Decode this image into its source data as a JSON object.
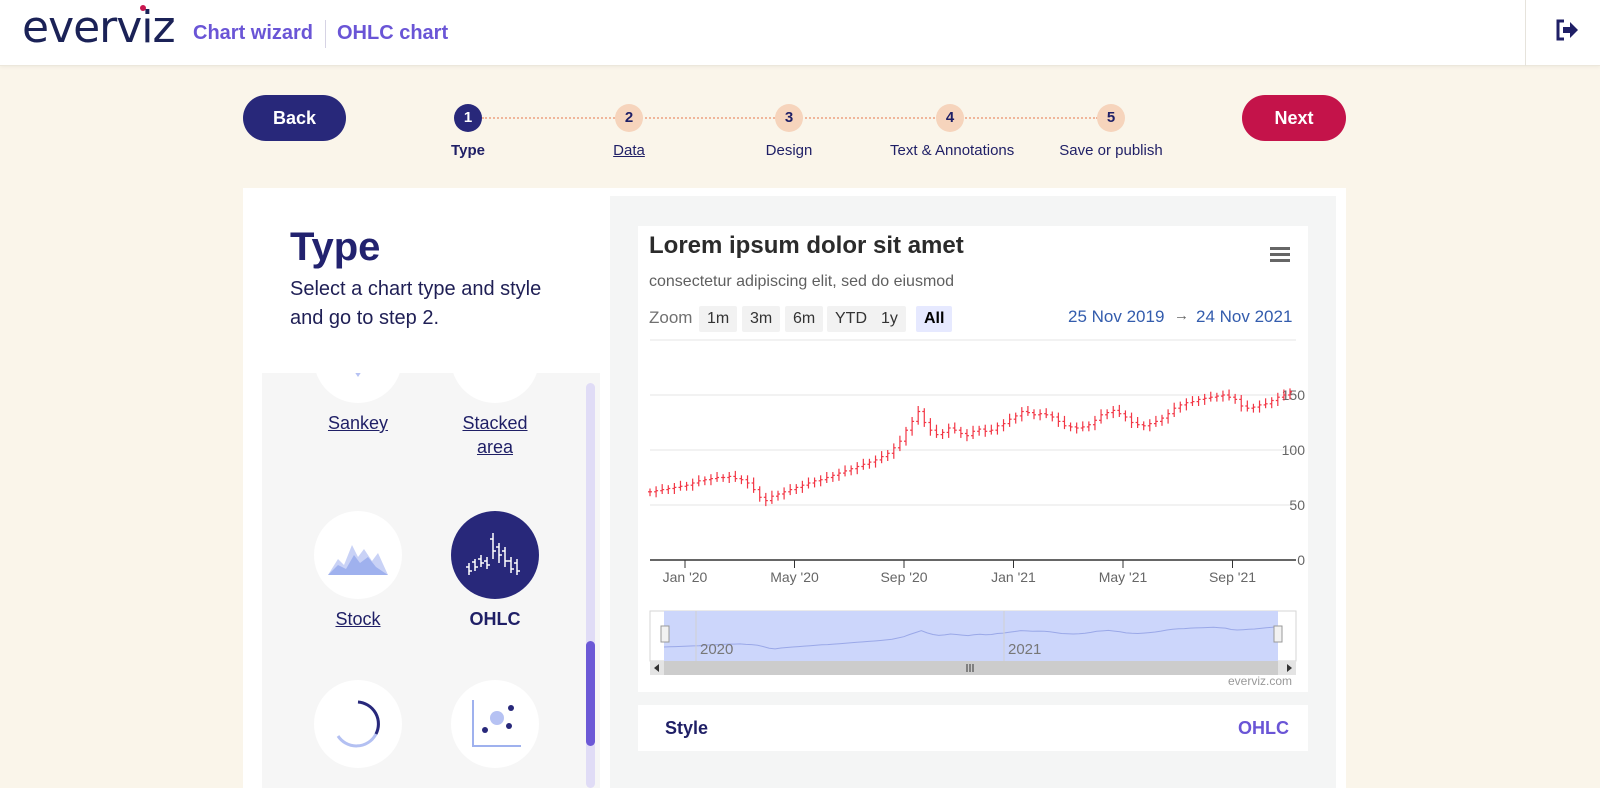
{
  "header": {
    "logo": "everviz",
    "breadcrumb": [
      "Chart wizard",
      "OHLC chart"
    ],
    "logout_icon": "logout-icon"
  },
  "stepper": {
    "back_label": "Back",
    "next_label": "Next",
    "steps": [
      {
        "number": "1",
        "label": "Type",
        "state": "active"
      },
      {
        "number": "2",
        "label": "Data",
        "state": "link"
      },
      {
        "number": "3",
        "label": "Design",
        "state": "normal"
      },
      {
        "number": "4",
        "label": "Text & Annotations",
        "state": "normal"
      },
      {
        "number": "5",
        "label": "Save or publish",
        "state": "normal"
      }
    ]
  },
  "type_panel": {
    "title": "Type",
    "description": "Select a chart type and style and go to step 2.",
    "tiles": [
      {
        "label": "Sankey",
        "icon": "sankey-icon",
        "selected": false
      },
      {
        "label": "Stacked area",
        "icon": "stacked-area-icon",
        "selected": false
      },
      {
        "label": "Stock",
        "icon": "stock-icon",
        "selected": false
      },
      {
        "label": "OHLC",
        "icon": "ohlc-icon",
        "selected": true
      },
      {
        "label": "",
        "icon": "gauge-icon",
        "selected": false
      },
      {
        "label": "",
        "icon": "bubble-icon",
        "selected": false
      }
    ]
  },
  "preview": {
    "zoom_label": "Zoom",
    "zoom_buttons": [
      "1m",
      "3m",
      "6m",
      "YTD",
      "1y",
      "All"
    ],
    "zoom_active": "All",
    "range_from": "25 Nov 2019",
    "range_arrow": "→",
    "range_to": "24 Nov 2021",
    "menu_icon": "hamburger-icon",
    "navigator_labels": [
      "2020",
      "2021"
    ],
    "credit": "everviz.com"
  },
  "style_row": {
    "label": "Style",
    "value": "OHLC"
  },
  "colors": {
    "accent": "#6a55d6",
    "navy": "#28287a",
    "next": "#c4134a",
    "series": "#f23645"
  },
  "chart_data": {
    "type": "ohlc",
    "title": "Lorem ipsum dolor sit amet",
    "subtitle": "consectetur adipiscing elit, sed do eiusmod",
    "x_tick_labels": [
      "Jan '20",
      "May '20",
      "Sep '20",
      "Jan '21",
      "May '21",
      "Sep '21"
    ],
    "y_ticks": [
      0,
      50,
      100,
      150
    ],
    "ylim": [
      0,
      200
    ],
    "xlim": [
      "2019-11-25",
      "2021-11-24"
    ],
    "ohlc_closes": [
      62,
      63,
      64,
      65,
      66,
      67,
      68,
      70,
      72,
      73,
      74,
      75,
      75,
      76,
      74,
      73,
      70,
      64,
      57,
      54,
      58,
      60,
      62,
      64,
      66,
      68,
      70,
      72,
      73,
      75,
      77,
      79,
      81,
      83,
      85,
      87,
      89,
      91,
      94,
      97,
      102,
      108,
      118,
      126,
      135,
      125,
      118,
      114,
      116,
      120,
      118,
      115,
      113,
      117,
      119,
      117,
      118,
      122,
      124,
      128,
      131,
      135,
      134,
      132,
      133,
      132,
      130,
      126,
      122,
      121,
      120,
      121,
      123,
      127,
      132,
      134,
      136,
      133,
      130,
      125,
      123,
      122,
      124,
      126,
      129,
      133,
      138,
      141,
      143,
      144,
      146,
      147,
      148,
      149,
      150,
      148,
      146,
      140,
      138,
      139,
      141,
      142,
      145,
      148,
      150,
      153
    ]
  }
}
